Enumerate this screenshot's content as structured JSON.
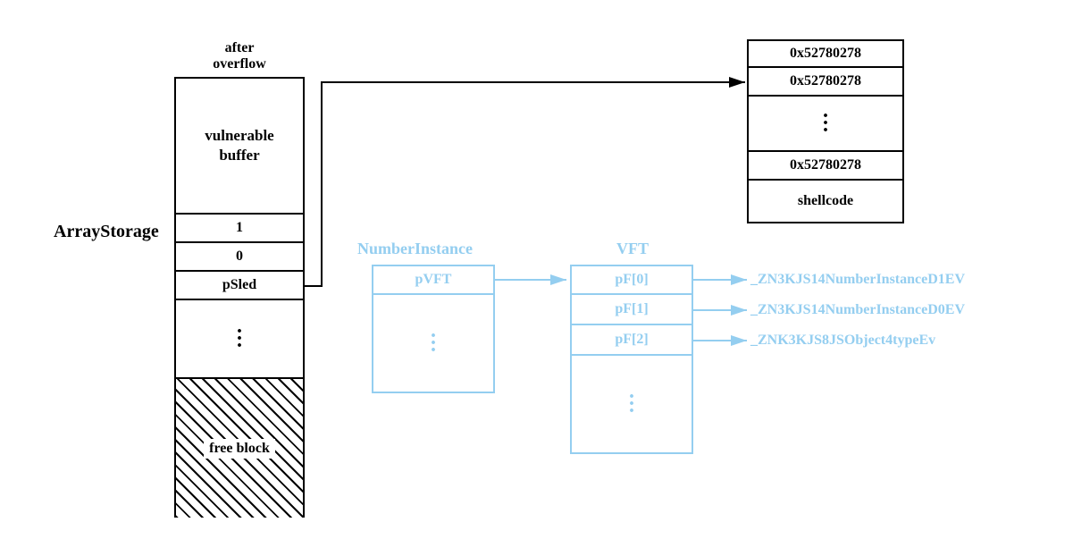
{
  "labels": {
    "afterOverflow1": "after",
    "afterOverflow2": "overflow",
    "arrayStorage": "ArrayStorage",
    "numberInstance": "NumberInstance",
    "vft": "VFT"
  },
  "leftCol": {
    "vulnBuf1": "vulnerable",
    "vulnBuf2": "buffer",
    "cell1": "1",
    "cell0": "0",
    "pSled": "pSled",
    "freeBlock": "free block"
  },
  "numberInstance": {
    "pVFT": "pVFT"
  },
  "vftCol": {
    "pf0": "pF[0]",
    "pf1": "pF[1]",
    "pf2": "pF[2]"
  },
  "symbols": {
    "s0": "_ZN3KJS14NumberInstanceD1EV",
    "s1": "_ZN3KJS14NumberInstanceD0EV",
    "s2": "_ZNK3KJS8JSObject4typeEv"
  },
  "rightCol": {
    "addr1": "0x52780278",
    "addr2": "0x52780278",
    "addr3": "0x52780278",
    "shellcode": "shellcode"
  }
}
